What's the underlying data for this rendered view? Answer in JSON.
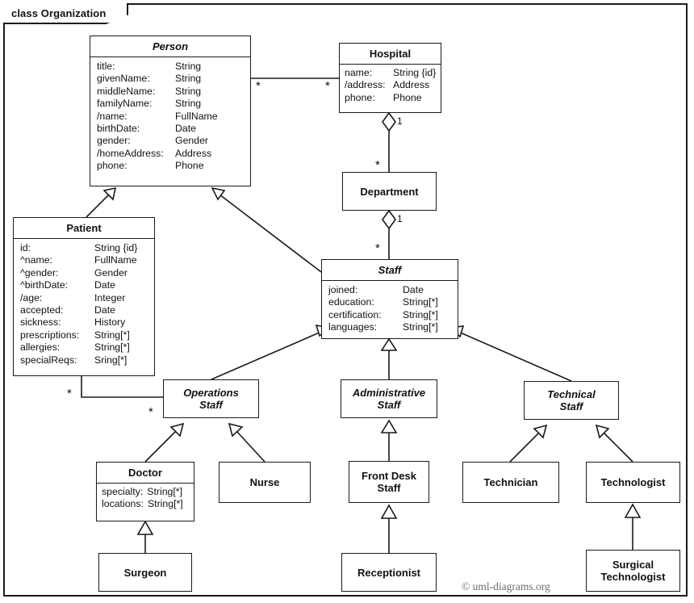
{
  "frame": {
    "label": "class Organization"
  },
  "watermark": {
    "text": "© uml-diagrams.org"
  },
  "classes": {
    "person": {
      "name": "Person",
      "abstract": true,
      "attributes": [
        {
          "name": "title:",
          "type": "String"
        },
        {
          "name": "givenName:",
          "type": "String"
        },
        {
          "name": "middleName:",
          "type": "String"
        },
        {
          "name": "familyName:",
          "type": "String"
        },
        {
          "name": "/name:",
          "type": "FullName"
        },
        {
          "name": "birthDate:",
          "type": "Date"
        },
        {
          "name": "gender:",
          "type": "Gender"
        },
        {
          "name": "/homeAddress:",
          "type": "Address"
        },
        {
          "name": "phone:",
          "type": "Phone"
        }
      ]
    },
    "hospital": {
      "name": "Hospital",
      "abstract": false,
      "attributes": [
        {
          "name": "name:",
          "type": "String {id}"
        },
        {
          "name": "/address:",
          "type": "Address"
        },
        {
          "name": "phone:",
          "type": "Phone"
        }
      ]
    },
    "department": {
      "name": "Department",
      "abstract": false,
      "attributes": []
    },
    "patient": {
      "name": "Patient",
      "abstract": false,
      "attributes": [
        {
          "name": "id:",
          "type": "String {id}"
        },
        {
          "name": "^name:",
          "type": "FullName"
        },
        {
          "name": "^gender:",
          "type": "Gender"
        },
        {
          "name": "^birthDate:",
          "type": "Date"
        },
        {
          "name": "/age:",
          "type": "Integer"
        },
        {
          "name": "accepted:",
          "type": "Date"
        },
        {
          "name": "sickness:",
          "type": "History"
        },
        {
          "name": "prescriptions:",
          "type": "String[*]"
        },
        {
          "name": "allergies:",
          "type": "String[*]"
        },
        {
          "name": "specialReqs:",
          "type": "Sring[*]"
        }
      ]
    },
    "staff": {
      "name": "Staff",
      "abstract": true,
      "attributes": [
        {
          "name": "joined:",
          "type": "Date"
        },
        {
          "name": "education:",
          "type": "String[*]"
        },
        {
          "name": "certification:",
          "type": "String[*]"
        },
        {
          "name": "languages:",
          "type": "String[*]"
        }
      ]
    },
    "operations_staff": {
      "name": "Operations\nStaff",
      "abstract": true,
      "attributes": []
    },
    "administrative_staff": {
      "name": "Administrative\nStaff",
      "abstract": true,
      "attributes": []
    },
    "technical_staff": {
      "name": "Technical\nStaff",
      "abstract": true,
      "attributes": []
    },
    "doctor": {
      "name": "Doctor",
      "abstract": false,
      "attributes": [
        {
          "name": "specialty:",
          "type": "String[*]"
        },
        {
          "name": "locations:",
          "type": "String[*]"
        }
      ]
    },
    "nurse": {
      "name": "Nurse",
      "abstract": false,
      "attributes": []
    },
    "front_desk_staff": {
      "name": "Front Desk\nStaff",
      "abstract": false,
      "attributes": []
    },
    "technician": {
      "name": "Technician",
      "abstract": false,
      "attributes": []
    },
    "technologist": {
      "name": "Technologist",
      "abstract": false,
      "attributes": []
    },
    "surgeon": {
      "name": "Surgeon",
      "abstract": false,
      "attributes": []
    },
    "receptionist": {
      "name": "Receptionist",
      "abstract": false,
      "attributes": []
    },
    "surgical_technologist": {
      "name": "Surgical\nTechnologist",
      "abstract": false,
      "attributes": []
    }
  },
  "multiplicities": {
    "person_hospital_person_end": "*",
    "person_hospital_hospital_end": "*",
    "hospital_department_hospital_end": "1",
    "hospital_department_department_end": "*",
    "department_staff_department_end": "1",
    "department_staff_staff_end": "*",
    "patient_operations_patient_end": "*",
    "patient_operations_operations_end": "*"
  },
  "relationships": [
    {
      "kind": "association",
      "from": "Person",
      "to": "Hospital"
    },
    {
      "kind": "aggregation",
      "from": "Hospital",
      "to": "Department"
    },
    {
      "kind": "aggregation",
      "from": "Department",
      "to": "Staff"
    },
    {
      "kind": "association",
      "from": "Patient",
      "to": "Operations Staff"
    },
    {
      "kind": "generalization",
      "from": "Patient",
      "to": "Person"
    },
    {
      "kind": "generalization",
      "from": "Staff",
      "to": "Person"
    },
    {
      "kind": "generalization",
      "from": "Operations Staff",
      "to": "Staff"
    },
    {
      "kind": "generalization",
      "from": "Administrative Staff",
      "to": "Staff"
    },
    {
      "kind": "generalization",
      "from": "Technical Staff",
      "to": "Staff"
    },
    {
      "kind": "generalization",
      "from": "Doctor",
      "to": "Operations Staff"
    },
    {
      "kind": "generalization",
      "from": "Nurse",
      "to": "Operations Staff"
    },
    {
      "kind": "generalization",
      "from": "Front Desk Staff",
      "to": "Administrative Staff"
    },
    {
      "kind": "generalization",
      "from": "Technician",
      "to": "Technical Staff"
    },
    {
      "kind": "generalization",
      "from": "Technologist",
      "to": "Technical Staff"
    },
    {
      "kind": "generalization",
      "from": "Surgeon",
      "to": "Doctor"
    },
    {
      "kind": "generalization",
      "from": "Receptionist",
      "to": "Front Desk Staff"
    },
    {
      "kind": "generalization",
      "from": "Surgical Technologist",
      "to": "Technologist"
    }
  ]
}
